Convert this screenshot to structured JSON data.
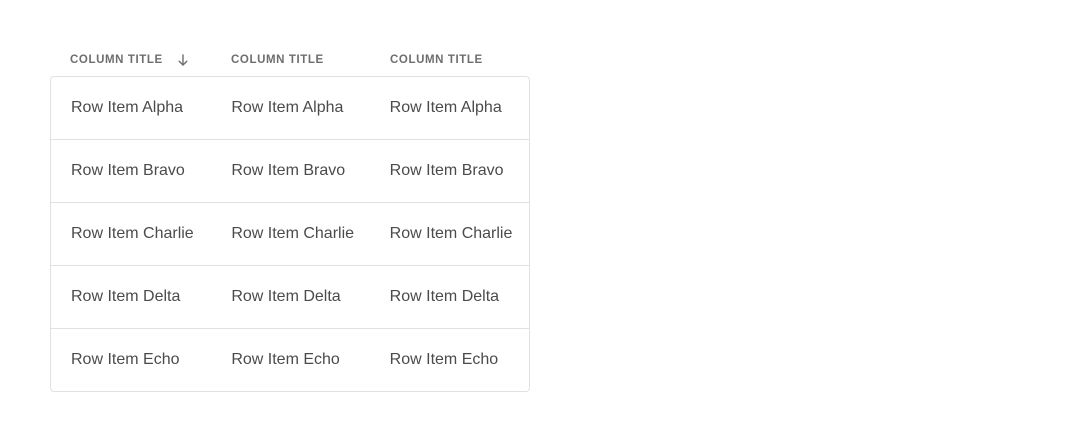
{
  "table": {
    "columns": [
      {
        "title": "COLUMN TITLE",
        "sort_icon": "arrow-down-icon"
      },
      {
        "title": "COLUMN TITLE"
      },
      {
        "title": "COLUMN TITLE"
      }
    ],
    "rows": [
      [
        "Row Item Alpha",
        "Row Item Alpha",
        "Row Item Alpha"
      ],
      [
        "Row Item Bravo",
        "Row Item Bravo",
        "Row Item Bravo"
      ],
      [
        "Row Item Charlie",
        "Row Item Charlie",
        "Row Item Charlie"
      ],
      [
        "Row Item Delta",
        "Row Item Delta",
        "Row Item Delta"
      ],
      [
        "Row Item Echo",
        "Row Item Echo",
        "Row Item Echo"
      ]
    ]
  },
  "colors": {
    "border": "#e1e1e1",
    "header_text": "#6e6e6e",
    "cell_text": "#4b4b4b"
  }
}
